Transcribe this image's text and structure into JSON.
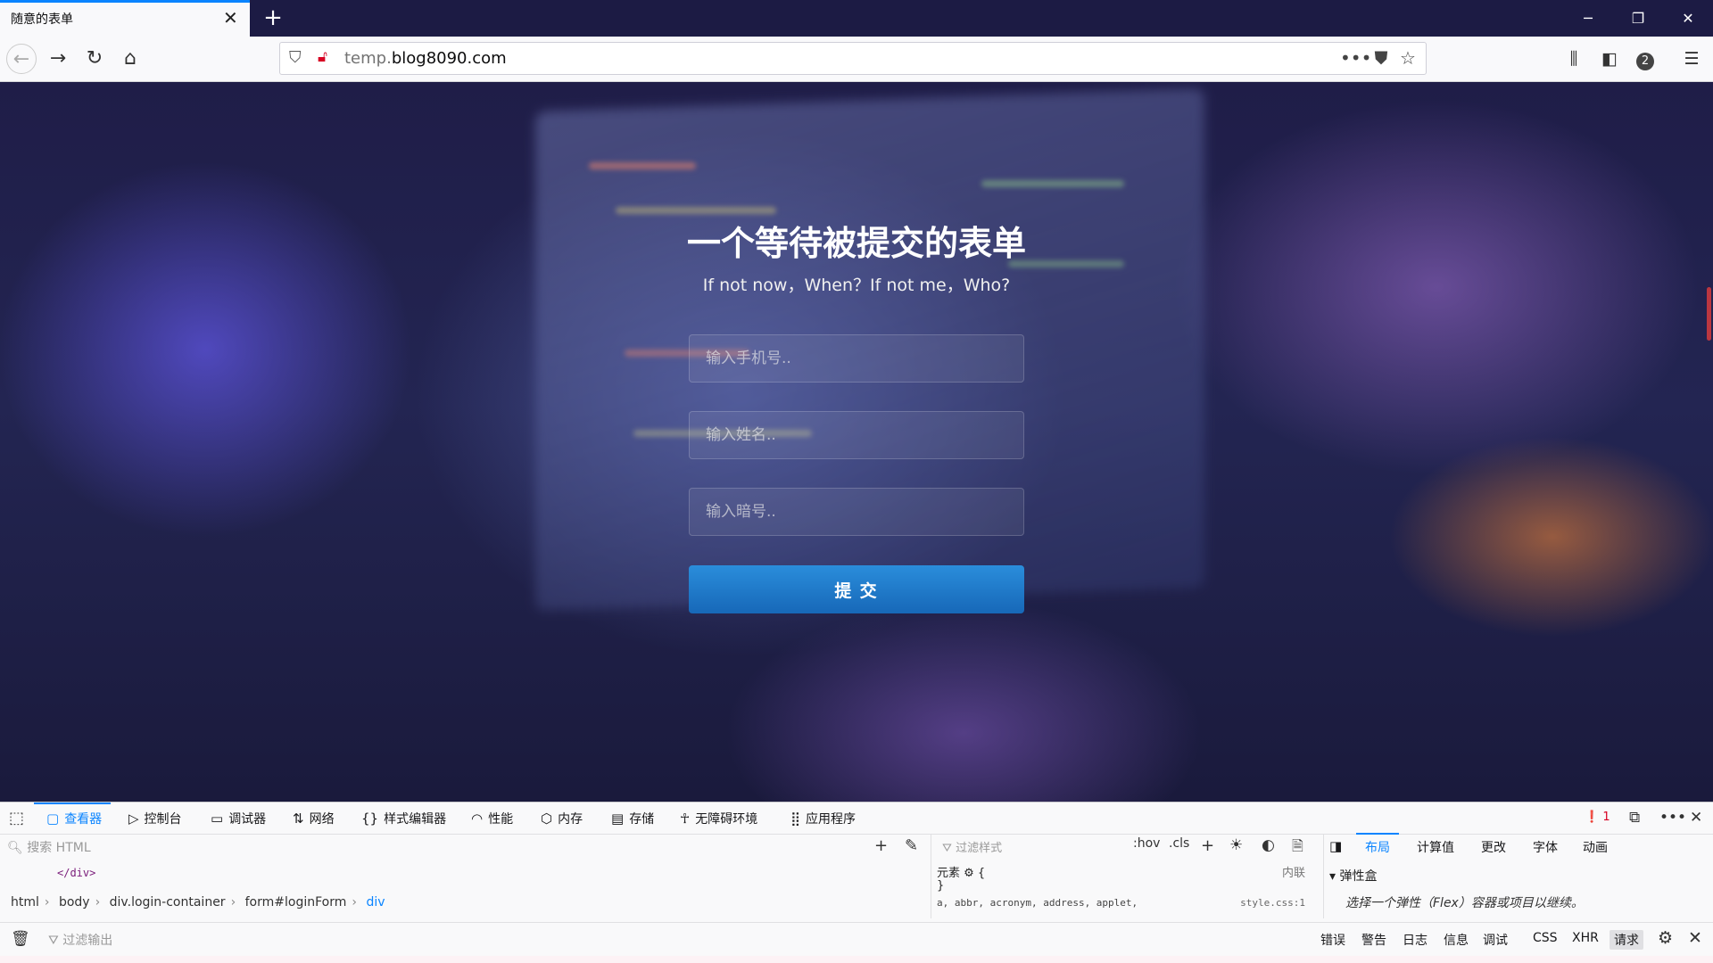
{
  "browser": {
    "tab_title": "随意的表单",
    "close_tab": "✕",
    "new_tab": "+",
    "url_host_prefix": "temp.",
    "url_host_domain": "blog8090.com",
    "account_badge": "2"
  },
  "form": {
    "title": "一个等待被提交的表单",
    "subtitle": "If not now，When？If not me，Who?",
    "phone_placeholder": "输入手机号..",
    "name_placeholder": "输入姓名..",
    "code_placeholder": "输入暗号..",
    "submit_label": "提 交"
  },
  "devtools": {
    "tabs": [
      {
        "label": "查看器",
        "icon": "inspector-icon"
      },
      {
        "label": "控制台",
        "icon": "console-icon"
      },
      {
        "label": "调试器",
        "icon": "debugger-icon"
      },
      {
        "label": "网络",
        "icon": "network-icon"
      },
      {
        "label": "样式编辑器",
        "icon": "style-editor-icon"
      },
      {
        "label": "性能",
        "icon": "performance-icon"
      },
      {
        "label": "内存",
        "icon": "memory-icon"
      },
      {
        "label": "存储",
        "icon": "storage-icon"
      },
      {
        "label": "无障碍环境",
        "icon": "accessibility-icon"
      },
      {
        "label": "应用程序",
        "icon": "application-icon"
      }
    ],
    "error_count": "1",
    "search_html_placeholder": "搜索 HTML",
    "code_snippet": "</div>",
    "breadcrumb": [
      "html",
      "body",
      "div.login-container",
      "form#loginForm",
      "div"
    ],
    "filter_styles_placeholder": "过滤样式",
    "hov_label": ":hov",
    "cls_label": ".cls",
    "rule_element": "元素 ⚙ {",
    "rule_inline": "内联",
    "rule_close": "}",
    "rule_selectors": "a, abbr, acronym, address, applet,",
    "rule_source": "style.css:1",
    "right_tabs": [
      "布局",
      "计算值",
      "更改",
      "字体",
      "动画"
    ],
    "flex_section": "弹性盒",
    "flex_hint": "选择一个弹性（Flex）容器或项目以继续。",
    "console_filter_placeholder": "过滤输出",
    "console_filters": [
      "错误",
      "警告",
      "日志",
      "信息",
      "调试",
      "CSS",
      "XHR",
      "请求"
    ]
  },
  "colors": {
    "accent": "#0a84ff",
    "submit_button": "#1f78c8",
    "titlebar": "#1c1b44"
  }
}
